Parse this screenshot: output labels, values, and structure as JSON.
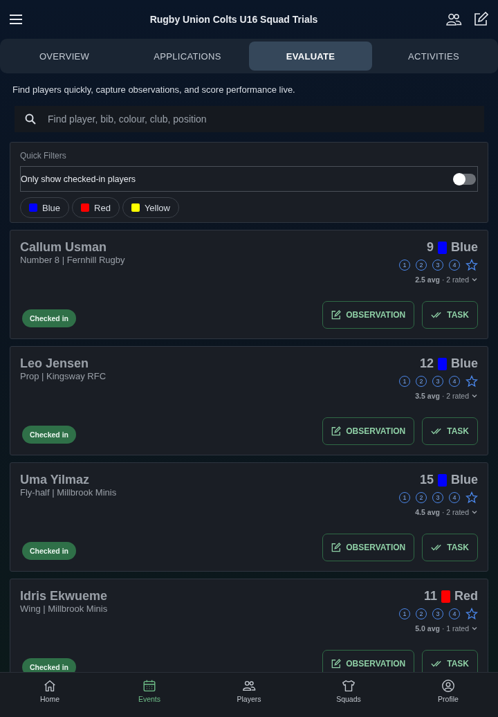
{
  "header": {
    "title": "Rugby Union Colts U16 Squad Trials"
  },
  "tabs": [
    {
      "label": "OVERVIEW",
      "selected": false
    },
    {
      "label": "APPLICATIONS",
      "selected": false
    },
    {
      "label": "EVALUATE",
      "selected": true
    },
    {
      "label": "ACTIVITIES",
      "selected": false
    }
  ],
  "intro": "Find players quickly, capture observations, and score performance live.",
  "search": {
    "placeholder": "Find player, bib, colour, club, position"
  },
  "filters": {
    "title": "Quick Filters",
    "toggle": {
      "label": "Only show checked-in players",
      "on": false
    },
    "chips": [
      {
        "label": "Blue",
        "color": "#0000ff"
      },
      {
        "label": "Red",
        "color": "#ff0000"
      },
      {
        "label": "Yellow",
        "color": "#ffff00"
      }
    ]
  },
  "players": [
    {
      "name": "Callum Usman",
      "detail": "Number 8 | Fernhill Rugby",
      "bib": "9",
      "team": "Blue",
      "color": "#0000ff",
      "ratings": [
        "1",
        "2",
        "3",
        "4"
      ],
      "avg": "2.5 avg",
      "rated": "· 2 rated",
      "status": "Checked in",
      "actions": [
        "OBSERVATION",
        "TASK"
      ]
    },
    {
      "name": "Leo Jensen",
      "detail": "Prop | Kingsway RFC",
      "bib": "12",
      "team": "Blue",
      "color": "#0000ff",
      "ratings": [
        "1",
        "2",
        "3",
        "4"
      ],
      "avg": "3.5 avg",
      "rated": "· 2 rated",
      "status": "Checked in",
      "actions": [
        "OBSERVATION",
        "TASK"
      ]
    },
    {
      "name": "Uma Yilmaz",
      "detail": "Fly-half | Millbrook Minis",
      "bib": "15",
      "team": "Blue",
      "color": "#0000ff",
      "ratings": [
        "1",
        "2",
        "3",
        "4"
      ],
      "avg": "4.5 avg",
      "rated": "· 2 rated",
      "status": "Checked in",
      "actions": [
        "OBSERVATION",
        "TASK"
      ]
    },
    {
      "name": "Idris Ekwueme",
      "detail": "Wing | Millbrook Minis",
      "bib": "11",
      "team": "Red",
      "color": "#ff0000",
      "ratings": [
        "1",
        "2",
        "3",
        "4"
      ],
      "avg": "5.0 avg",
      "rated": "· 1 rated",
      "status": "Checked in",
      "actions": [
        "OBSERVATION",
        "TASK"
      ]
    }
  ],
  "nav": [
    {
      "label": "Home",
      "kind": "home",
      "selected": false
    },
    {
      "label": "Events",
      "kind": "calendar",
      "selected": true
    },
    {
      "label": "Players",
      "kind": "people",
      "selected": false
    },
    {
      "label": "Squads",
      "kind": "shirt",
      "selected": false
    },
    {
      "label": "Profile",
      "kind": "profile",
      "selected": false
    }
  ]
}
